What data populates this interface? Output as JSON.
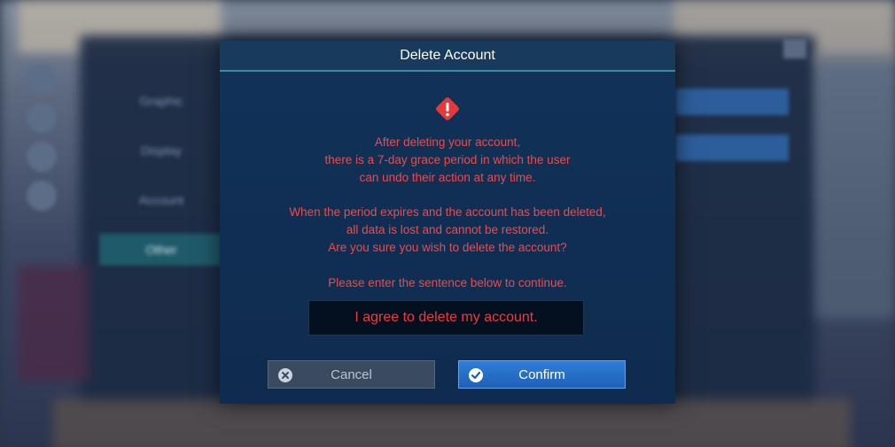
{
  "background": {
    "side_menu": [
      "Graphic",
      "Display",
      "Account",
      "Other"
    ],
    "active_item": "Other"
  },
  "dialog": {
    "title": "Delete Account",
    "icon": "warning-icon",
    "message_lines": [
      "After deleting your account,",
      "there is a 7-day grace period in which the user",
      "can undo their action at any time.",
      "When the period expires and the account has been deleted,",
      "all data is lost and cannot be restored.",
      "Are you sure you wish to delete the account?",
      "Please enter the sentence below to continue."
    ],
    "confirm_sentence": "I agree to delete my account.",
    "cancel_label": "Cancel",
    "confirm_label": "Confirm"
  },
  "colors": {
    "warning": "#ee4a4a",
    "header_accent": "#3a8da0",
    "confirm_button": "#2f7fd8",
    "cancel_button": "#3a4b5f"
  }
}
